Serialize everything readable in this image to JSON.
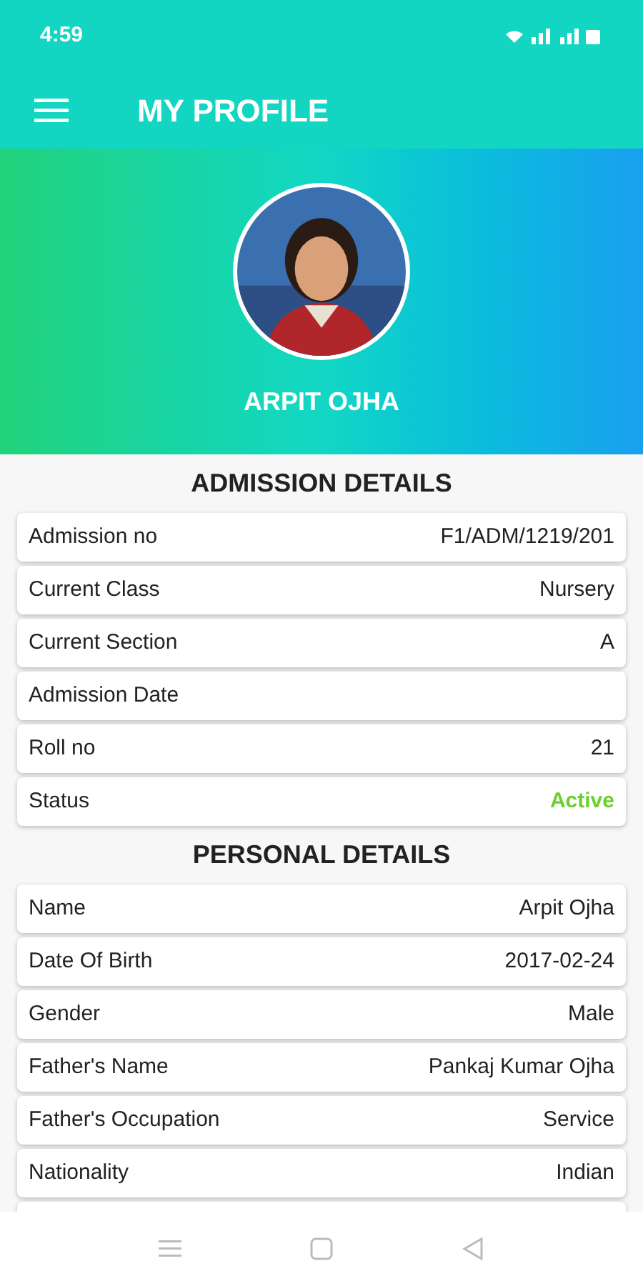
{
  "status_bar": {
    "time": "4:59"
  },
  "app_bar": {
    "title": "MY PROFILE"
  },
  "profile": {
    "name": "ARPIT OJHA"
  },
  "sections": [
    {
      "title": "ADMISSION DETAILS",
      "rows": [
        {
          "kind": "plain",
          "label": "Admission no",
          "value": "F1/ADM/1219/201"
        },
        {
          "kind": "plain",
          "label": "Current Class",
          "value": "Nursery"
        },
        {
          "kind": "plain",
          "label": "Current Section",
          "value": "A"
        },
        {
          "kind": "plain",
          "label": "Admission Date"
        },
        {
          "kind": "plain",
          "label": "Roll no",
          "value": "21"
        },
        {
          "kind": "status",
          "label": "Status",
          "value": "Active"
        }
      ]
    },
    {
      "title": "PERSONAL DETAILS",
      "rows": [
        {
          "kind": "plain",
          "label": "Name",
          "value": "Arpit Ojha"
        },
        {
          "kind": "plain",
          "label": "Date Of Birth",
          "value": "2017-02-24"
        },
        {
          "kind": "plain",
          "label": "Gender",
          "value": "Male"
        },
        {
          "kind": "plain",
          "label": "Father's Name",
          "value": "Pankaj Kumar Ojha"
        },
        {
          "kind": "plain",
          "label": "Father's Occupation",
          "value": "Service"
        },
        {
          "kind": "plain",
          "label": "Nationality",
          "value": "Indian"
        }
      ]
    }
  ]
}
